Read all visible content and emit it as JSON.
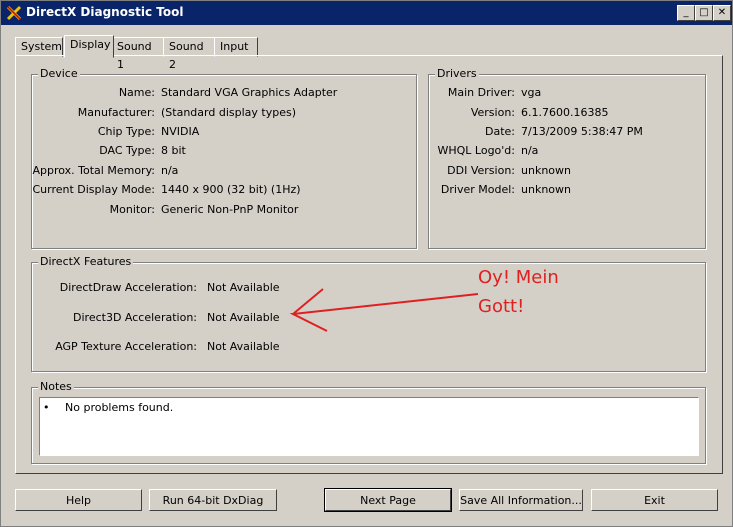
{
  "window": {
    "title": "DirectX Diagnostic Tool"
  },
  "tabs": [
    {
      "label": "System"
    },
    {
      "label": "Display"
    },
    {
      "label": "Sound 1"
    },
    {
      "label": "Sound 2"
    },
    {
      "label": "Input"
    }
  ],
  "device": {
    "legend": "Device",
    "rows": [
      {
        "label": "Name:",
        "value": "Standard VGA Graphics Adapter"
      },
      {
        "label": "Manufacturer:",
        "value": "(Standard display types)"
      },
      {
        "label": "Chip Type:",
        "value": "NVIDIA"
      },
      {
        "label": "DAC Type:",
        "value": "8 bit"
      },
      {
        "label": "Approx. Total Memory:",
        "value": "n/a"
      },
      {
        "label": "Current Display Mode:",
        "value": "1440 x 900 (32 bit) (1Hz)"
      },
      {
        "label": "Monitor:",
        "value": "Generic Non-PnP Monitor"
      }
    ]
  },
  "drivers": {
    "legend": "Drivers",
    "rows": [
      {
        "label": "Main Driver:",
        "value": "vga"
      },
      {
        "label": "Version:",
        "value": "6.1.7600.16385"
      },
      {
        "label": "Date:",
        "value": "7/13/2009 5:38:47 PM"
      },
      {
        "label": "WHQL Logo'd:",
        "value": "n/a"
      },
      {
        "label": "DDI Version:",
        "value": "unknown"
      },
      {
        "label": "Driver Model:",
        "value": "unknown"
      }
    ]
  },
  "features": {
    "legend": "DirectX Features",
    "rows": [
      {
        "label": "DirectDraw Acceleration:",
        "value": "Not Available"
      },
      {
        "label": "Direct3D Acceleration:",
        "value": "Not Available"
      },
      {
        "label": "AGP Texture Acceleration:",
        "value": "Not Available"
      }
    ]
  },
  "notes": {
    "legend": "Notes",
    "bullet": "•",
    "text": "No problems found."
  },
  "annotation": {
    "line1": "Oy! Mein",
    "line2": "Gott!",
    "color": "#e02020"
  },
  "buttons": {
    "help": "Help",
    "run64": "Run 64-bit DxDiag",
    "next": "Next Page",
    "save": "Save All Information...",
    "exit": "Exit"
  },
  "colors": {
    "titlebar": "#0a246a",
    "face": "#d4d0c8",
    "annotation": "#e02020"
  }
}
